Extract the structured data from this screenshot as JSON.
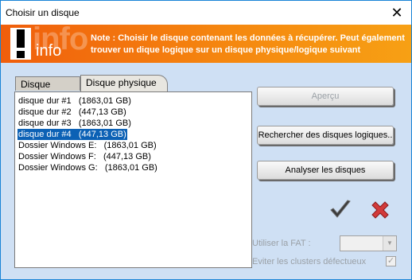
{
  "window": {
    "title": "Choisir un disque",
    "close_glyph": "✕"
  },
  "banner": {
    "logo_text": "info",
    "logo_bg_text": "info",
    "note": "Note : Choisir le disque contenant les données à récupérer. Peut également trouver un dique logique sur un disque physique/logique suivant",
    "colors": {
      "start": "#f05e0c",
      "end": "#f7a014"
    }
  },
  "tabs": [
    {
      "label": "Disque logique",
      "active": false
    },
    {
      "label": "Disque physique",
      "active": true
    }
  ],
  "disks": [
    {
      "name": "disque dur #1",
      "size": "(1863,01 GB)",
      "selected": false
    },
    {
      "name": "disque dur #2",
      "size": "(447,13 GB)",
      "selected": false
    },
    {
      "name": "disque dur #3",
      "size": "(1863,01 GB)",
      "selected": false
    },
    {
      "name": "disque dur #4",
      "size": "(447,13 GB)",
      "selected": true
    },
    {
      "name": "Dossier Windows E:",
      "size": "(1863,01 GB)",
      "selected": false
    },
    {
      "name": "Dossier Windows F:",
      "size": "(447,13 GB)",
      "selected": false
    },
    {
      "name": "Dossier Windows G:",
      "size": "(1863,01 GB)",
      "selected": false
    }
  ],
  "buttons": {
    "apercu": "Aperçu",
    "rechercher": "Rechercher des disques logiques..",
    "analyser": "Analyser les disques"
  },
  "icons": {
    "ok": "checkmark-icon",
    "cancel": "red-x-icon"
  },
  "options": {
    "fat_label": "Utiliser la FAT :",
    "fat_value": "",
    "clusters_label": "Eviter les clusters défectueux",
    "clusters_checked": true
  },
  "colors": {
    "selection": "#0c61b5",
    "window_bg": "#cfe0f4",
    "ok": "#3a3a3a",
    "cancel": "#d23a3a"
  }
}
